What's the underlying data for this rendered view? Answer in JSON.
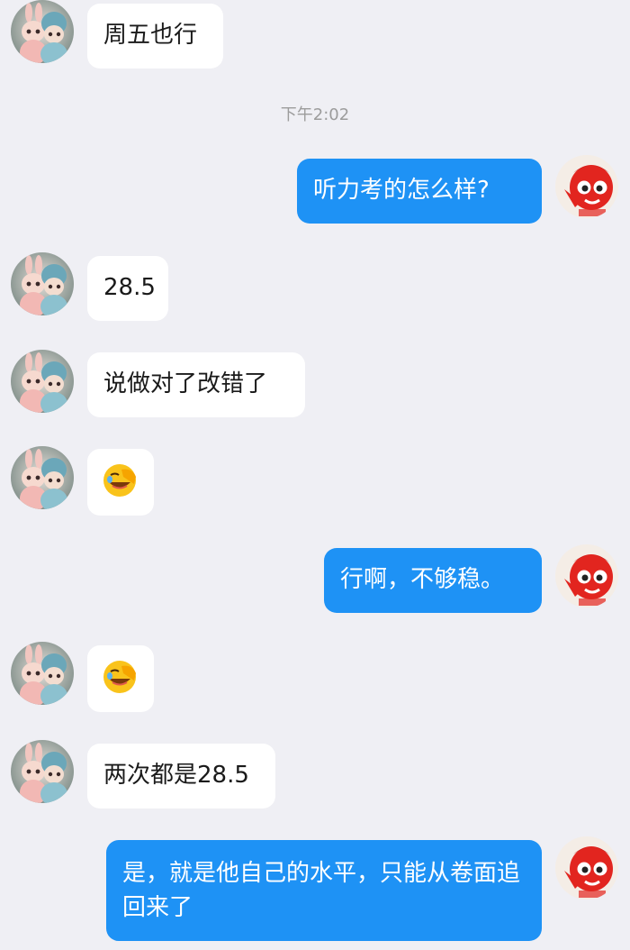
{
  "contacts": {
    "other_avatar_icon": "bunny-couple-avatar-icon",
    "self_avatar_icon": "red-mascot-avatar-icon"
  },
  "colors": {
    "background": "#efeff4",
    "incoming_bubble": "#ffffff",
    "outgoing_bubble": "#1e92f5",
    "timestamp": "#9c9c9c"
  },
  "timestamp": "下午2:02",
  "messages": [
    {
      "from": "other",
      "type": "text",
      "text": "周五也行"
    },
    {
      "from": "self",
      "type": "text",
      "text": "听力考的怎么样?"
    },
    {
      "from": "other",
      "type": "text",
      "text": "28.5"
    },
    {
      "from": "other",
      "type": "text",
      "text": "说做对了改错了"
    },
    {
      "from": "other",
      "type": "emoji",
      "icon": "facepalm-tear-emoji-icon"
    },
    {
      "from": "self",
      "type": "text",
      "text": "行啊，不够稳。"
    },
    {
      "from": "other",
      "type": "emoji",
      "icon": "facepalm-tear-emoji-icon"
    },
    {
      "from": "other",
      "type": "text",
      "text": "两次都是28.5"
    },
    {
      "from": "self",
      "type": "text",
      "text": "是，就是他自己的水平，只能从卷面追回来了"
    }
  ]
}
